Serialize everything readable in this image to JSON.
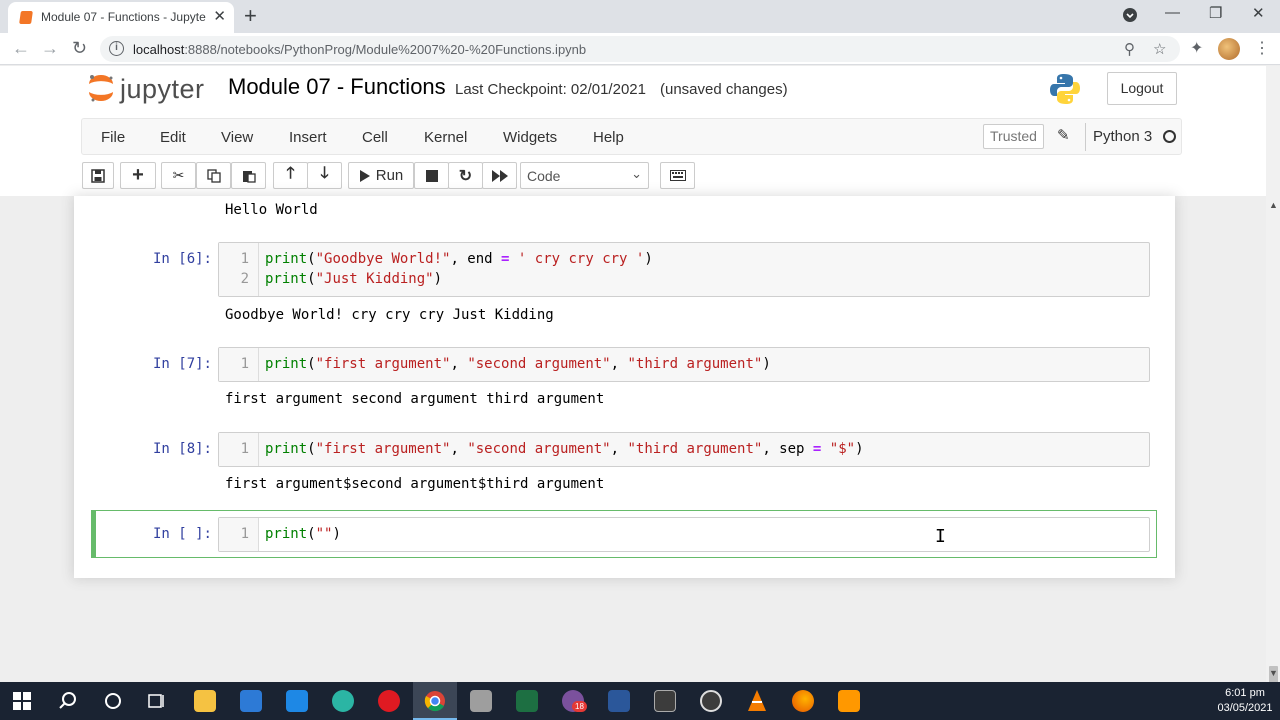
{
  "browser": {
    "tab_title": "Module 07 - Functions - Jupyter",
    "tab_close": "✕",
    "new_tab": "+",
    "url_host": "localhost",
    "url_path": ":8888/notebooks/PythonProg/Module%2007%20-%20Functions.ipynb",
    "win_minimize": "—",
    "win_restore": "❐",
    "win_close": "✕"
  },
  "header": {
    "logo_text": "jupyter",
    "notebook_title": "Module 07 - Functions",
    "checkpoint": "Last Checkpoint: 02/01/2021",
    "save_status": "(unsaved changes)",
    "logout_label": "Logout"
  },
  "menu": {
    "items": [
      "File",
      "Edit",
      "View",
      "Insert",
      "Cell",
      "Kernel",
      "Widgets",
      "Help"
    ],
    "trusted": "Trusted",
    "kernel": "Python 3"
  },
  "toolbar": {
    "run_label": "Run",
    "cell_type": "Code"
  },
  "cells": [
    {
      "prompt": "In [6]:",
      "lines": [
        "print(\"Goodbye World!\", end = ' cry cry cry ')",
        "print(\"Just Kidding\")"
      ],
      "output": "Goodbye World! cry cry cry Just Kidding"
    },
    {
      "prompt": "In [7]:",
      "lines": [
        "print(\"first argument\", \"second argument\", \"third argument\")"
      ],
      "output": "first argument second argument third argument"
    },
    {
      "prompt": "In [8]:",
      "lines": [
        "print(\"first argument\", \"second argument\", \"third argument\", sep = \"$\")"
      ],
      "output": "first argument$second argument$third argument"
    },
    {
      "prompt": "In [ ]:",
      "lines": [
        "print(\"\")"
      ],
      "output": ""
    }
  ],
  "previous_output": "Hello World",
  "line_numbers": [
    "1",
    "2"
  ],
  "taskbar": {
    "clock_time": "6:01 pm",
    "clock_date": "03/05/2021",
    "viber_badge": "18"
  },
  "colors": {
    "prompt_in": "#303f9f",
    "string": "#ba2121",
    "builtin": "#008000",
    "selected_border": "#66bb6a"
  }
}
